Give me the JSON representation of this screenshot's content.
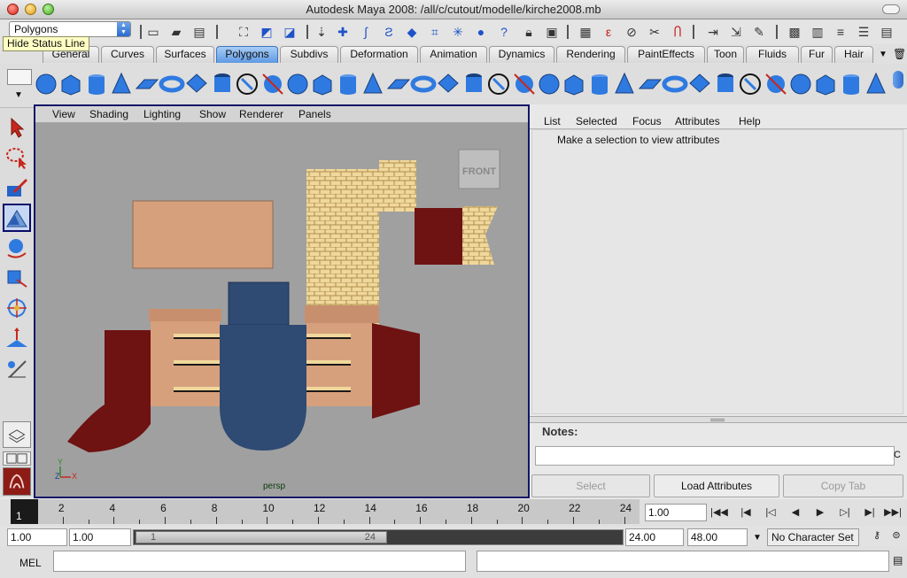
{
  "window": {
    "title": "Autodesk Maya 2008: /all/c/cutout/modelle/kirche2008.mb"
  },
  "status_line": {
    "menu_set": "Polygons",
    "tooltip": "Hide Status Line",
    "icons": [
      "new-scene-icon",
      "open-scene-icon",
      "save-scene-icon",
      "select-hierarchy-icon",
      "select-object-icon",
      "select-component-icon",
      "snap-grid-icon",
      "snap-curve-icon",
      "snap-point-icon",
      "snap-surface-icon",
      "snap-view-plane-icon",
      "live-icon",
      "history-icon",
      "render-icon",
      "ipr-icon",
      "render-settings-icon",
      "show-hide-icon",
      "channel-box-icon"
    ]
  },
  "shelf_tabs": {
    "active": "Polygons",
    "tabs": [
      "General",
      "Curves",
      "Surfaces",
      "Polygons",
      "Subdivs",
      "Deformation",
      "Animation",
      "Dynamics",
      "Rendering",
      "PaintEffects",
      "Toon",
      "Fluids",
      "Fur",
      "Hair"
    ]
  },
  "shelf": {
    "icons": [
      "poly-sphere-icon",
      "poly-cube-icon",
      "poly-cylinder-icon",
      "poly-cone-icon",
      "poly-plane-icon",
      "poly-torus-icon",
      "poly-prism-icon",
      "poly-pipe-icon",
      "poly-helix-icon",
      "poly-soccer-ball-icon",
      "combine-icon",
      "separate-icon",
      "smooth-icon",
      "bevel-icon",
      "extrude-icon",
      "bridge-icon",
      "append-polygon-icon",
      "split-polygon-icon",
      "insert-edge-loop-icon",
      "offset-edge-loop-icon",
      "extract-icon",
      "duplicate-face-icon",
      "merge-vertices-icon",
      "wedge-icon",
      "poke-icon",
      "chamfer-icon",
      "reduce-icon",
      "cleanup-icon",
      "triangulate-icon",
      "quadrangulate-icon",
      "sculpt-icon",
      "checker-icon",
      "uv-editor-icon",
      "soft-mod-icon"
    ]
  },
  "toolbox": {
    "tools": [
      "select-tool-icon",
      "lasso-tool-icon",
      "paint-select-tool-icon",
      "move-tool-icon",
      "rotate-tool-icon",
      "scale-tool-icon",
      "universal-manipulator-icon",
      "soft-mod-tool-icon",
      "show-manipulator-icon",
      "last-tool-icon"
    ],
    "active_index": 3
  },
  "viewport": {
    "menus": [
      "View",
      "Shading",
      "Lighting",
      "Show",
      "Renderer",
      "Panels"
    ],
    "view_cube": "FRONT",
    "camera": "persp",
    "axis_x": "X",
    "axis_y": "Y",
    "axis_z": "Z",
    "colors": {
      "background": "#a0a0a0",
      "roof_tan": "#d7a07c",
      "blue": "#2f4a73",
      "maroon": "#6e1212",
      "brick": "#f0d79b"
    }
  },
  "attribute_editor": {
    "menus": [
      "List",
      "Selected",
      "Focus",
      "Attributes",
      "Help"
    ],
    "message": "Make a selection to view attributes",
    "notes_label": "Notes:",
    "buttons": {
      "select": "Select",
      "load": "Load Attributes",
      "copy_tab": "Copy Tab"
    }
  },
  "time_slider": {
    "current_frame": "1",
    "ticks": [
      "2",
      "4",
      "6",
      "8",
      "10",
      "12",
      "14",
      "16",
      "18",
      "20",
      "22",
      "24"
    ],
    "current_time": "1.00"
  },
  "range_slider": {
    "start_time": "1.00",
    "range_start": "1.00",
    "thumb_start": "1",
    "thumb_end": "24",
    "range_end": "24.00",
    "end_time": "48.00",
    "character_set": "No Character Set"
  },
  "command_line": {
    "label": "MEL",
    "input": "",
    "result": ""
  }
}
